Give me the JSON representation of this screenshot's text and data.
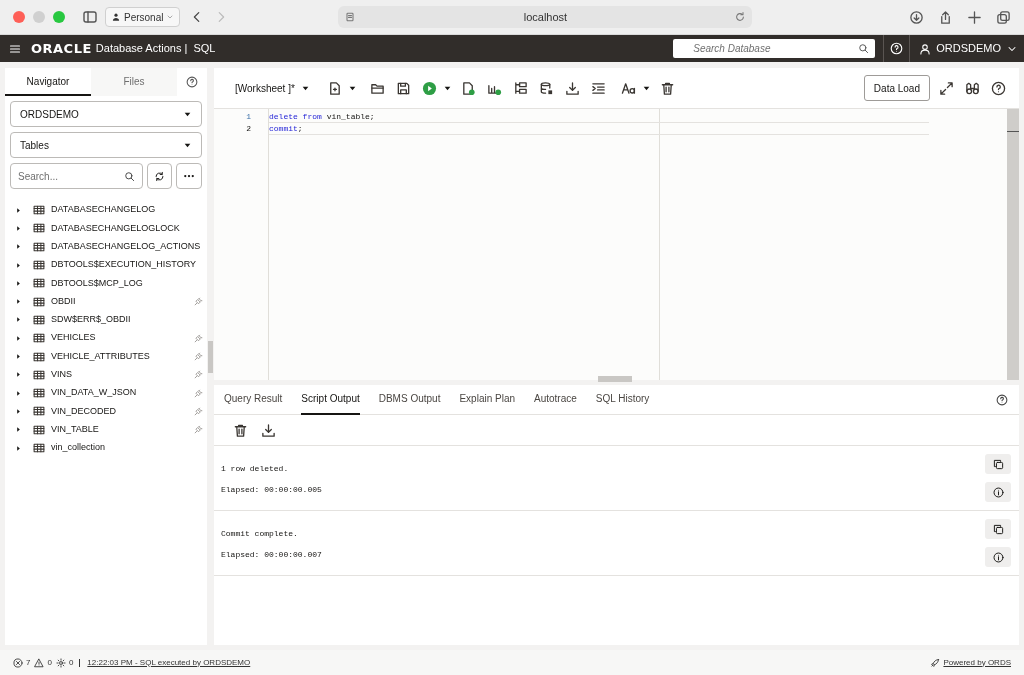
{
  "browser": {
    "profile": "Personal",
    "url": "localhost"
  },
  "header": {
    "brand": "ORACLE",
    "product": "Database Actions |  SQL",
    "search_placeholder": "Search Database",
    "user": "ORDSDEMO"
  },
  "navigator": {
    "tabs": [
      {
        "label": "Navigator",
        "selected": true
      },
      {
        "label": "Files",
        "selected": false
      }
    ],
    "schema": "ORDSDEMO",
    "object_type": "Tables",
    "search_placeholder": "Search...",
    "tables": [
      {
        "name": "DATABASECHANGELOG",
        "rest_enabled": false
      },
      {
        "name": "DATABASECHANGELOGLOCK",
        "rest_enabled": false
      },
      {
        "name": "DATABASECHANGELOG_ACTIONS",
        "rest_enabled": false
      },
      {
        "name": "DBTOOLS$EXECUTION_HISTORY",
        "rest_enabled": false
      },
      {
        "name": "DBTOOLS$MCP_LOG",
        "rest_enabled": false
      },
      {
        "name": "OBDII",
        "rest_enabled": true
      },
      {
        "name": "SDW$ERR$_OBDII",
        "rest_enabled": false
      },
      {
        "name": "VEHICLES",
        "rest_enabled": true
      },
      {
        "name": "VEHICLE_ATTRIBUTES",
        "rest_enabled": true
      },
      {
        "name": "VINS",
        "rest_enabled": true
      },
      {
        "name": "VIN_DATA_W_JSON",
        "rest_enabled": true
      },
      {
        "name": "VIN_DECODED",
        "rest_enabled": true
      },
      {
        "name": "VIN_TABLE",
        "rest_enabled": true
      },
      {
        "name": "vin_collection",
        "rest_enabled": false
      }
    ]
  },
  "toolbar": {
    "worksheet": "[Worksheet ]*",
    "data_load": "Data Load"
  },
  "editor": {
    "lines": [
      {
        "number": "1",
        "tokens": [
          {
            "text": "delete",
            "kind": "keyword"
          },
          {
            "text": " from",
            "kind": "keyword"
          },
          {
            "text": " vin_table;"
          }
        ]
      },
      {
        "number": "2",
        "tokens": [
          {
            "text": "commit",
            "kind": "keyword"
          },
          {
            "text": ";"
          }
        ]
      }
    ]
  },
  "results": {
    "tabs": [
      {
        "label": "Query Result",
        "selected": false
      },
      {
        "label": "Script Output",
        "selected": true
      },
      {
        "label": "DBMS Output",
        "selected": false
      },
      {
        "label": "Explain Plan",
        "selected": false
      },
      {
        "label": "Autotrace",
        "selected": false
      },
      {
        "label": "SQL History",
        "selected": false
      }
    ],
    "outputs": [
      {
        "message": "1 row deleted.",
        "elapsed": "Elapsed: 00:00:00.005"
      },
      {
        "message": "Commit complete.",
        "elapsed": "Elapsed: 00:00:00.007"
      }
    ]
  },
  "status_bar": {
    "errors": "7",
    "warnings": "0",
    "settings": "0",
    "message": "12:22:03 PM - SQL executed by ORDSDEMO",
    "powered": "Powered by ORDS"
  }
}
